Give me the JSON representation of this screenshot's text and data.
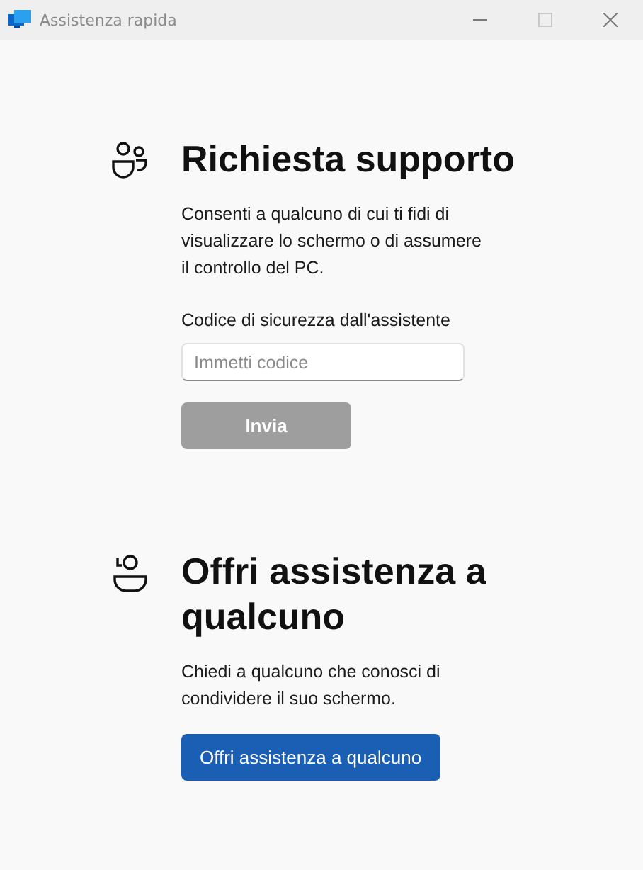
{
  "window": {
    "title": "Assistenza rapida",
    "controls": [
      {
        "kind": "minimize",
        "disabled": false
      },
      {
        "kind": "maximize",
        "disabled": true
      },
      {
        "kind": "close",
        "disabled": false
      }
    ]
  },
  "sections": [
    {
      "kind": "request",
      "title": "Richiesta supporto",
      "description": "Consenti a qualcuno di cui ti fidi di visualizzare lo schermo o di assumere il controllo del PC.",
      "field_label": "Codice di sicurezza dall'assistente",
      "field": {
        "placeholder": "Immetti codice"
      },
      "button": {
        "label": "Invia",
        "disabled": true
      }
    },
    {
      "kind": "offer",
      "title": "Offri assistenza a qualcuno",
      "description": "Chiedi a qualcuno che conosci di condividere il suo schermo.",
      "button": {
        "label": "Offri assistenza a qualcuno",
        "disabled": false
      }
    }
  ]
}
